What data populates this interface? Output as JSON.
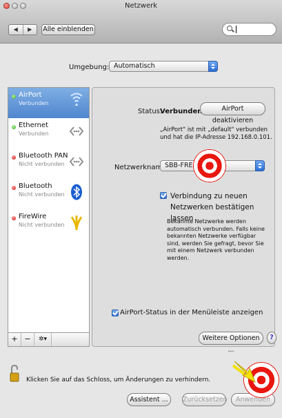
{
  "window": {
    "title": "Netzwerk"
  },
  "toolbar": {
    "back_label": "◀",
    "forward_label": "▶",
    "show_all_label": "Alle einblenden",
    "search_value": ""
  },
  "location": {
    "label": "Umgebung:",
    "value": "Automatisch"
  },
  "services": [
    {
      "name": "AirPort",
      "status": "Verbunden",
      "state": "green",
      "icon": "wifi-icon"
    },
    {
      "name": "Ethernet",
      "status": "Verbunden",
      "state": "green",
      "icon": "ethernet-icon"
    },
    {
      "name": "Bluetooth PAN",
      "status": "Nicht verbunden",
      "state": "red",
      "icon": "ethernet-icon"
    },
    {
      "name": "Bluetooth",
      "status": "Nicht verbunden",
      "state": "red",
      "icon": "bluetooth-icon"
    },
    {
      "name": "FireWire",
      "status": "Nicht verbunden",
      "state": "red",
      "icon": "firewire-icon"
    }
  ],
  "sidebar_controls": {
    "add": "+",
    "remove": "−",
    "gear": "✲▾"
  },
  "detail": {
    "status_label": "Status:",
    "status_value": "Verbunden",
    "deactivate_label": "AirPort deaktivieren",
    "description": "„AirPort\" ist mit „default\" verbunden und hat die IP-Adresse 192.168.0.101.",
    "network_name_label": "Netzwerkname:",
    "network_name_value": "SBB-FREE",
    "ask_join_label": "Verbindung zu neuen Netzwerken bestätigen lassen",
    "ask_join_help": "Bekannte Netzwerke werden automatisch verbunden. Falls keine bekannten Netzwerke verfügbar sind, werden Sie gefragt, bevor Sie mit einem Netzwerk verbunden werden.",
    "show_status_label": "AirPort-Status in der Menüleiste anzeigen",
    "advanced_label": "Weitere Optionen ...",
    "help_label": "?"
  },
  "footer": {
    "lock_text": "Klicken Sie auf das Schloss, um Änderungen zu verhindern.",
    "assistant_label": "Assistent ...",
    "revert_label": "Zurücksetzen",
    "apply_label": "Anwenden"
  },
  "colors": {
    "selection": "#5b8fd6",
    "accent": "#2c6ed5",
    "target_red": "#e8170f",
    "arrow_yellow": "#f5e000"
  }
}
